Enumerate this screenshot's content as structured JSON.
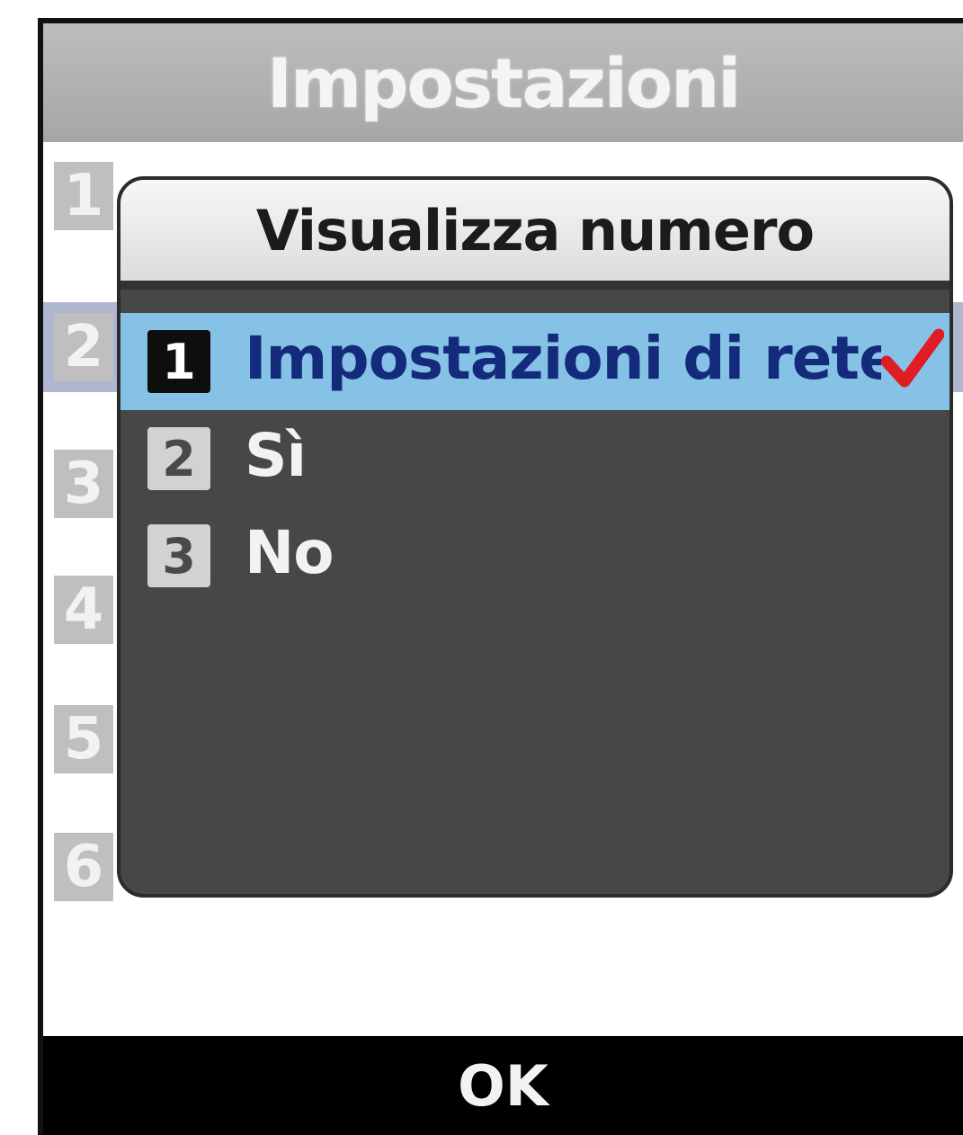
{
  "screen": {
    "title": "Impostazioni"
  },
  "background_list": {
    "items": [
      {
        "number": "1"
      },
      {
        "number": "2"
      },
      {
        "number": "3"
      },
      {
        "number": "4"
      },
      {
        "number": "5"
      },
      {
        "number": "6"
      }
    ],
    "selected_index": 1,
    "selected_color": "#aeb7cf"
  },
  "popup": {
    "title": "Visualizza numero",
    "options": [
      {
        "number": "1",
        "label": "Impostazioni  di rete",
        "selected": true,
        "checked": true
      },
      {
        "number": "2",
        "label": "Sì",
        "selected": false,
        "checked": false
      },
      {
        "number": "3",
        "label": "No",
        "selected": false,
        "checked": false
      }
    ],
    "highlight_color": "#86c2e6",
    "check_color": "#e01c24"
  },
  "softkey": {
    "center_label": "OK"
  }
}
